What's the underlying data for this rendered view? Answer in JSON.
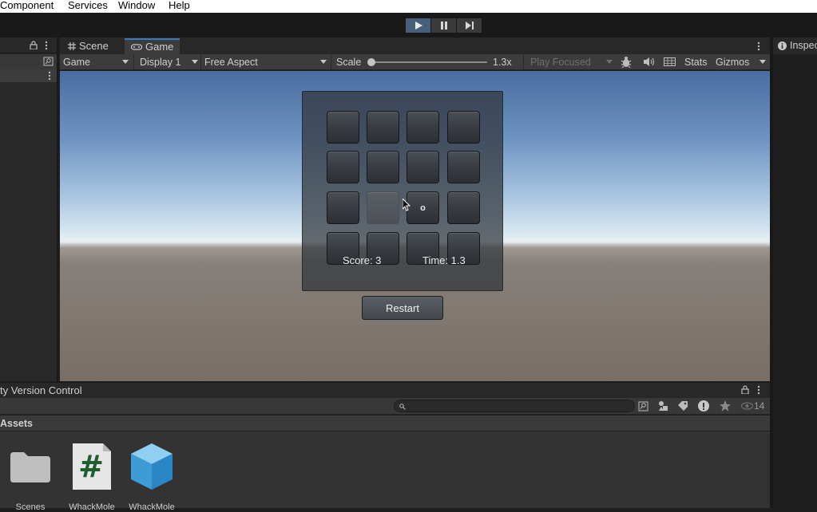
{
  "menu": [
    "Component",
    "Services",
    "Window",
    "Help"
  ],
  "playbar": {
    "play": "play-icon",
    "pause": "pause-icon",
    "step": "step-icon"
  },
  "tabs": {
    "scene": "Scene",
    "game": "Game"
  },
  "gameToolbar": {
    "view": "Game",
    "display": "Display 1",
    "aspect": "Free Aspect",
    "scale_label": "Scale",
    "scale_value": "1.3x",
    "play_mode": "Play Focused",
    "stats": "Stats",
    "gizmos": "Gizmos"
  },
  "game": {
    "grid_marks": [
      "",
      "",
      "",
      "",
      "",
      "",
      "",
      "",
      "",
      "",
      "o",
      "",
      "",
      "",
      "",
      ""
    ],
    "score": "Score: 3",
    "time": "Time: 1.3",
    "restart": "Restart"
  },
  "inspector": {
    "title": "Inspector"
  },
  "bottom": {
    "tab": "ty Version Control",
    "assets_header": "Assets",
    "hidden_count": "14",
    "assets": [
      {
        "name": "Scenes",
        "icon": "folder-icon"
      },
      {
        "name": "WhackMole",
        "icon": "csharp-script-icon"
      },
      {
        "name": "WhackMole",
        "icon": "prefab-cube-icon"
      }
    ]
  },
  "colors": {
    "accent": "#3a79bb",
    "play_active": "#46607c"
  }
}
